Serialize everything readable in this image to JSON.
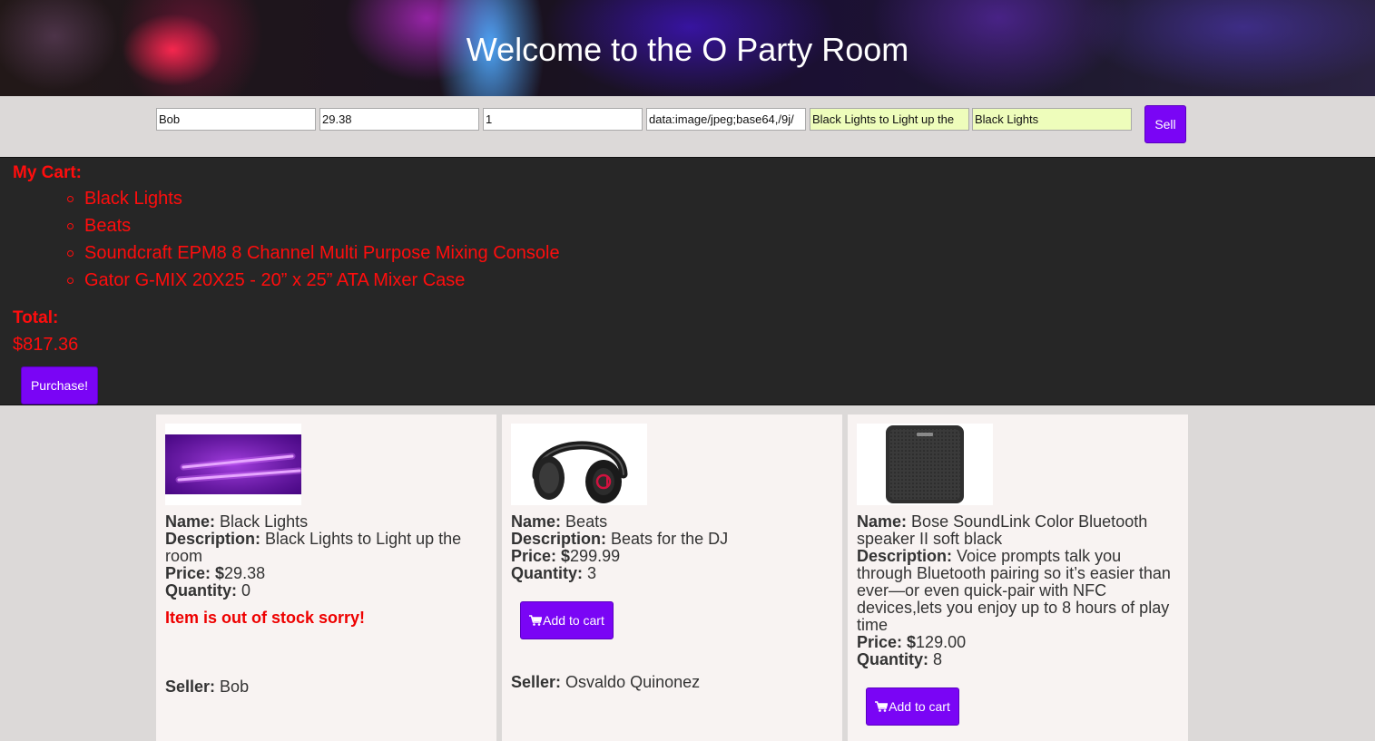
{
  "header": {
    "title": "Welcome to the O Party Room"
  },
  "sell_form": {
    "seller_value": "Bob",
    "price_value": "29.38",
    "quantity_value": "1",
    "image_value": "data:image/jpeg;base64,/9j/",
    "description_value": "Black Lights to Light up the",
    "name_value": "Black Lights",
    "sell_label": "Sell"
  },
  "cart": {
    "heading": "My Cart:",
    "items": [
      "Black Lights",
      "Beats",
      "Soundcraft EPM8 8 Channel Multi Purpose Mixing Console",
      "Gator G-MIX 20X25 - 20” x 25” ATA Mixer Case"
    ],
    "total_label": "Total:",
    "total_value": "$817.36",
    "purchase_label": "Purchase!"
  },
  "labels": {
    "name": "Name:",
    "description": "Description:",
    "price": "Price: $",
    "quantity": "Quantity:",
    "seller": "Seller:",
    "add_to_cart": "Add to cart",
    "out_of_stock": "Item is out of stock sorry!"
  },
  "products": [
    {
      "name": "Black Lights",
      "description": "Black Lights to Light up the room",
      "price": "29.38",
      "quantity": "0",
      "seller": "Bob",
      "image_icon": "black-light-tubes"
    },
    {
      "name": "Beats",
      "description": "Beats for the DJ",
      "price": "299.99",
      "quantity": "3",
      "seller": "Osvaldo Quinonez",
      "image_icon": "headphones"
    },
    {
      "name": "Bose SoundLink Color Bluetooth speaker II soft black",
      "description": "Voice prompts talk you through Bluetooth pairing so it’s easier than ever—or even quick-pair with NFC devices,lets you enjoy up to 8 hours of play time",
      "price": "129.00",
      "quantity": "8",
      "image_icon": "bluetooth-speaker"
    }
  ],
  "colors": {
    "accent_purple": "#7a05f5",
    "cart_text_red": "#ff0d0d",
    "cart_background": "#262626",
    "card_background": "#f8f3f2"
  }
}
